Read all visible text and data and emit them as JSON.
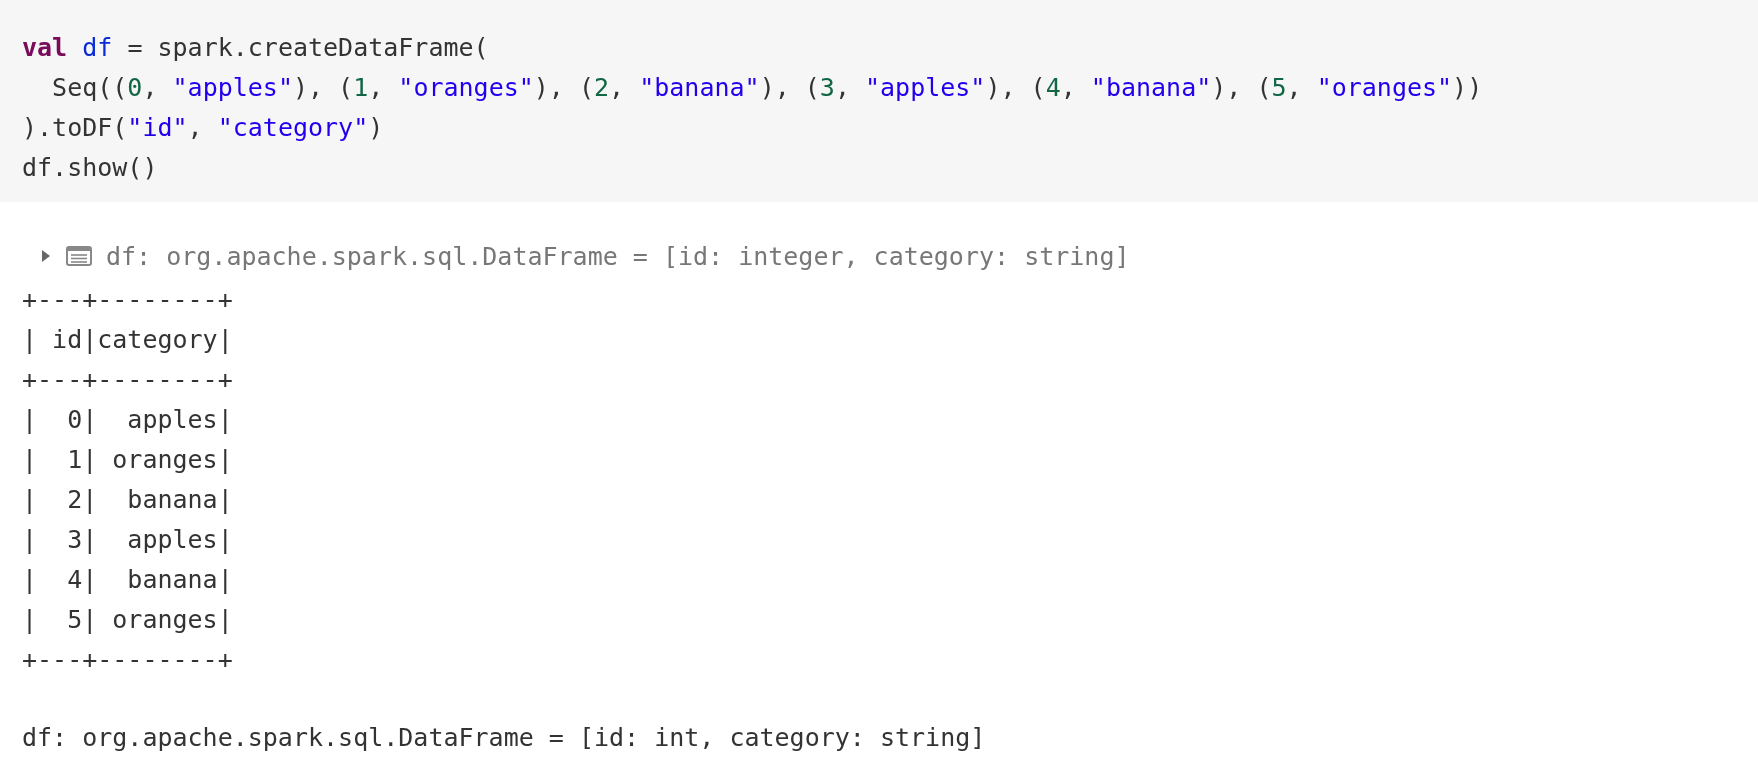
{
  "code_cell": {
    "lines": [
      [
        {
          "kind": "keyword",
          "text": "val "
        },
        {
          "kind": "variable",
          "text": "df"
        },
        {
          "kind": "plain",
          "text": " = spark.createDataFrame("
        }
      ],
      [
        {
          "kind": "plain",
          "text": "  Seq(("
        },
        {
          "kind": "number",
          "text": "0"
        },
        {
          "kind": "plain",
          "text": ", "
        },
        {
          "kind": "string",
          "text": "\"apples\""
        },
        {
          "kind": "plain",
          "text": "), ("
        },
        {
          "kind": "number",
          "text": "1"
        },
        {
          "kind": "plain",
          "text": ", "
        },
        {
          "kind": "string",
          "text": "\"oranges\""
        },
        {
          "kind": "plain",
          "text": "), ("
        },
        {
          "kind": "number",
          "text": "2"
        },
        {
          "kind": "plain",
          "text": ", "
        },
        {
          "kind": "string",
          "text": "\"banana\""
        },
        {
          "kind": "plain",
          "text": "), ("
        },
        {
          "kind": "number",
          "text": "3"
        },
        {
          "kind": "plain",
          "text": ", "
        },
        {
          "kind": "string",
          "text": "\"apples\""
        },
        {
          "kind": "plain",
          "text": "), ("
        },
        {
          "kind": "number",
          "text": "4"
        },
        {
          "kind": "plain",
          "text": ", "
        },
        {
          "kind": "string",
          "text": "\"banana\""
        },
        {
          "kind": "plain",
          "text": "), ("
        },
        {
          "kind": "number",
          "text": "5"
        },
        {
          "kind": "plain",
          "text": ", "
        },
        {
          "kind": "string",
          "text": "\"oranges\""
        },
        {
          "kind": "plain",
          "text": "))"
        }
      ],
      [
        {
          "kind": "plain",
          "text": ").toDF("
        },
        {
          "kind": "string",
          "text": "\"id\""
        },
        {
          "kind": "plain",
          "text": ", "
        },
        {
          "kind": "string",
          "text": "\"category\""
        },
        {
          "kind": "plain",
          "text": ")"
        }
      ],
      [
        {
          "kind": "plain",
          "text": "df.show()"
        }
      ]
    ]
  },
  "result": {
    "expanded": false,
    "schema": "df: org.apache.spark.sql.DataFrame = [id: integer, category: string]",
    "output_lines": [
      "+---+--------+",
      "| id|category|",
      "+---+--------+",
      "|  0|  apples|",
      "|  1| oranges|",
      "|  2|  banana|",
      "|  3|  apples|",
      "|  4|  banana|",
      "|  5| oranges|",
      "+---+--------+"
    ],
    "summary": "df: org.apache.spark.sql.DataFrame = [id: int, category: string]"
  }
}
